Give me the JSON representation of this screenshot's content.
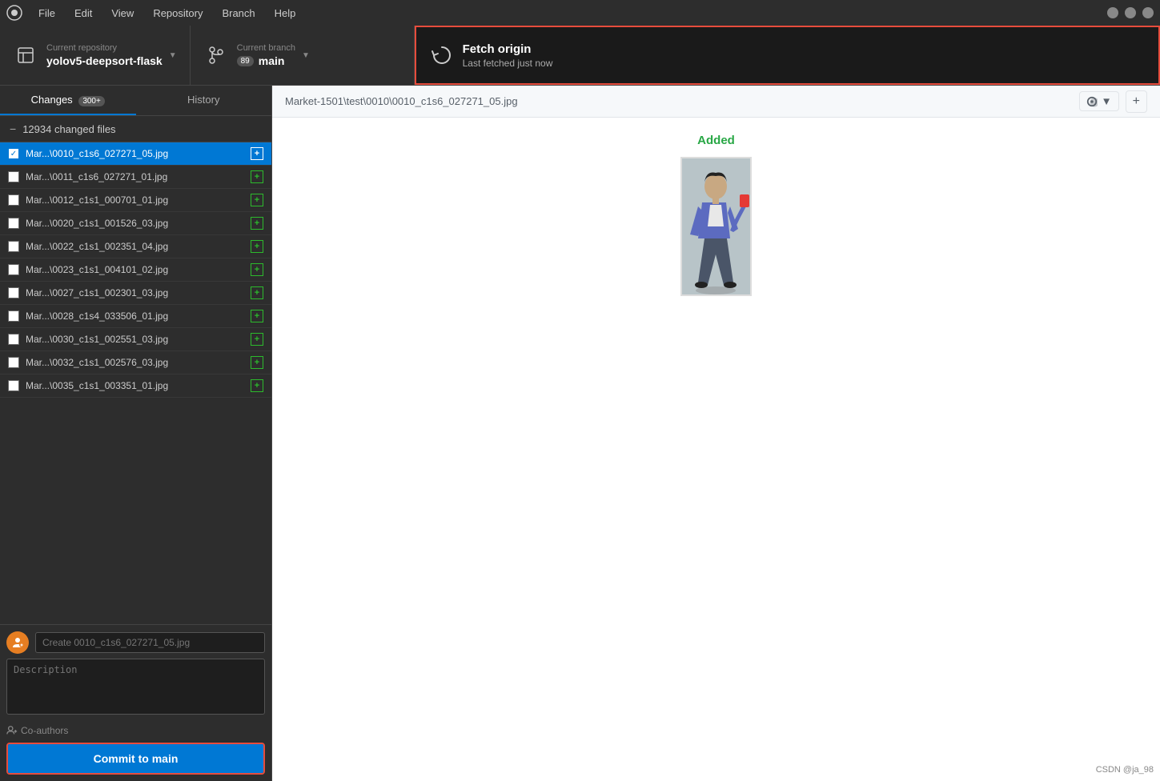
{
  "titleBar": {
    "menuItems": [
      "File",
      "Edit",
      "View",
      "Repository",
      "Branch",
      "Help"
    ],
    "windowControls": [
      "minimize",
      "maximize",
      "close"
    ]
  },
  "toolbar": {
    "repo": {
      "label": "Current repository",
      "value": "yolov5-deepsort-flask"
    },
    "branch": {
      "label": "Current branch",
      "value": "main",
      "badge": "89"
    },
    "fetch": {
      "label": "Fetch origin",
      "sublabel": "Last fetched just now"
    }
  },
  "sidebar": {
    "tabs": [
      {
        "label": "Changes",
        "badge": "300+",
        "active": true
      },
      {
        "label": "History",
        "active": false
      }
    ],
    "changedFiles": {
      "count": "12934 changed files"
    },
    "files": [
      {
        "name": "Mar...\\0010_c1s6_027271_05.jpg",
        "checked": true,
        "active": true
      },
      {
        "name": "Mar...\\0011_c1s6_027271_01.jpg",
        "checked": false,
        "active": false
      },
      {
        "name": "Mar...\\0012_c1s1_000701_01.jpg",
        "checked": false,
        "active": false
      },
      {
        "name": "Mar...\\0020_c1s1_001526_03.jpg",
        "checked": false,
        "active": false
      },
      {
        "name": "Mar...\\0022_c1s1_002351_04.jpg",
        "checked": false,
        "active": false
      },
      {
        "name": "Mar...\\0023_c1s1_004101_02.jpg",
        "checked": false,
        "active": false
      },
      {
        "name": "Mar...\\0027_c1s1_002301_03.jpg",
        "checked": false,
        "active": false
      },
      {
        "name": "Mar...\\0028_c1s4_033506_01.jpg",
        "checked": false,
        "active": false
      },
      {
        "name": "Mar...\\0030_c1s1_002551_03.jpg",
        "checked": false,
        "active": false
      },
      {
        "name": "Mar...\\0032_c1s1_002576_03.jpg",
        "checked": false,
        "active": false
      },
      {
        "name": "Mar...\\0035_c1s1_003351_01.jpg",
        "checked": false,
        "active": false
      }
    ],
    "commit": {
      "summaryPlaceholder": "Create 0010_c1s6_027271_05.jpg",
      "descriptionPlaceholder": "Description",
      "coAuthorsLabel": "Co-authors",
      "buttonLabel": "Commit to ",
      "buttonBranch": "main"
    }
  },
  "content": {
    "breadcrumb": "Market-1501\\test\\0010\\0010_c1s6_027271_05.jpg",
    "addedLabel": "Added"
  },
  "watermark": "CSDN @ja_98"
}
